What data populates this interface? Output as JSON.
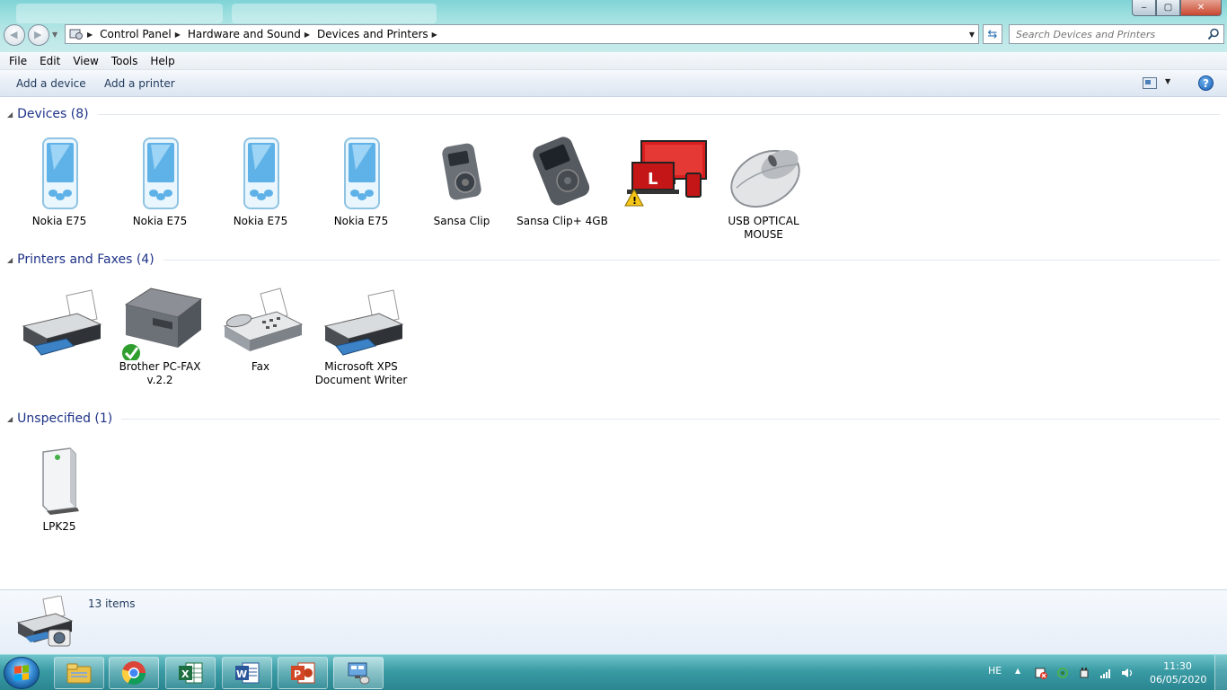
{
  "window": {
    "address": {
      "crumbs": [
        "Control Panel",
        "Hardware and Sound",
        "Devices and Printers"
      ]
    },
    "search": {
      "placeholder": "Search Devices and Printers"
    },
    "buttons": {
      "minimize": "‒",
      "maximize": "▢",
      "close": "✕"
    }
  },
  "menu": [
    "File",
    "Edit",
    "View",
    "Tools",
    "Help"
  ],
  "commands": {
    "add_device": "Add a device",
    "add_printer": "Add a printer",
    "help": "?"
  },
  "groups": {
    "devices": {
      "title": "Devices (8)",
      "items": [
        "Nokia E75",
        "Nokia E75",
        "Nokia E75",
        "Nokia E75",
        "Sansa Clip",
        "Sansa Clip+ 4GB",
        "",
        "USB OPTICAL MOUSE"
      ]
    },
    "printers": {
      "title": "Printers and Faxes (4)",
      "items": [
        "",
        "Brother PC-FAX v.2.2",
        "Fax",
        "Microsoft XPS Document Writer"
      ]
    },
    "unspecified": {
      "title": "Unspecified (1)",
      "items": [
        "LPK25"
      ]
    }
  },
  "details": {
    "count": "13 items"
  },
  "taskbar": {
    "apps": [
      "file-explorer",
      "chrome",
      "excel",
      "word",
      "powerpoint",
      "devices-and-printers"
    ],
    "lang": "HE",
    "time": "11:30",
    "date": "06/05/2020"
  },
  "colors": {
    "group_title": "#1e3287",
    "taskbar": "#3a9ba5",
    "link": "#1e395b"
  }
}
